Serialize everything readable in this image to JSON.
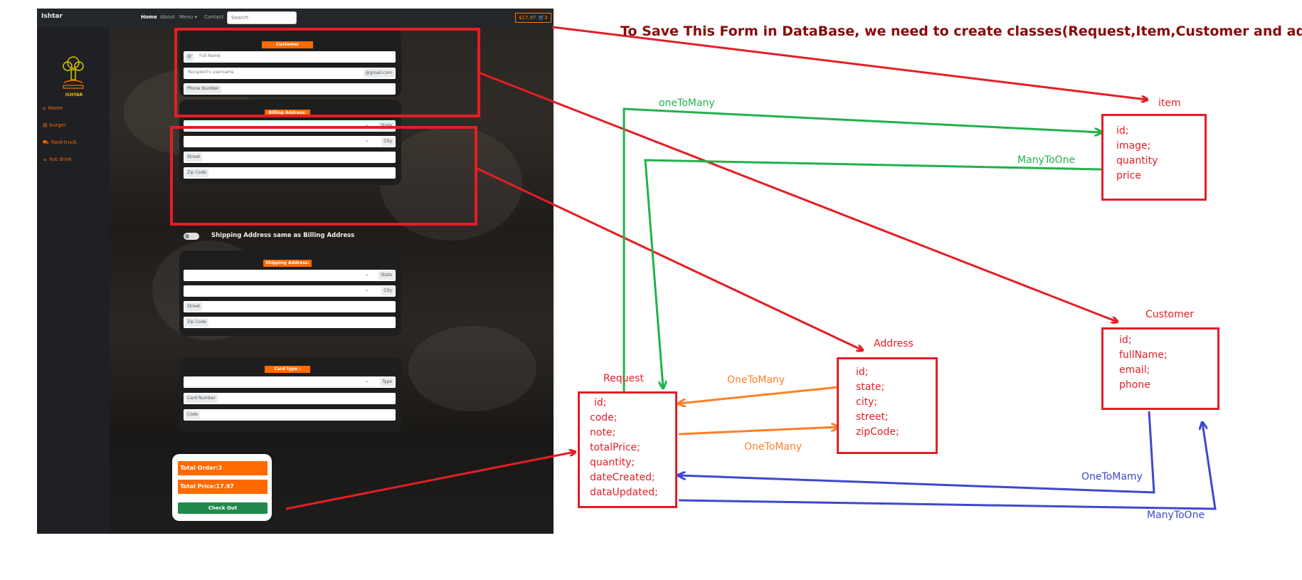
{
  "screenshot": {
    "brand": "Ishtar",
    "nav": {
      "home": "Home",
      "about": "About",
      "menu": "Menu ▾",
      "contact": "Contact"
    },
    "search_placeholder": "Search",
    "cart_total": "$17.97",
    "cart_count": "3",
    "logo_text": "ISHTAR",
    "sidebar": [
      {
        "icon": "home-icon",
        "label": "Home"
      },
      {
        "icon": "burger-icon",
        "label": "burger"
      },
      {
        "icon": "food-truck-icon",
        "label": "food-truck"
      },
      {
        "icon": "hot-drink-icon",
        "label": "hot drink"
      }
    ],
    "customer": {
      "legend": "Customer",
      "fullname_prefix": "@",
      "fullname_placeholder": "Full Name",
      "email_placeholder": "Recipient's username",
      "email_suffix": "@gmail.com",
      "phone_label": "Phone Number"
    },
    "billing": {
      "legend": "Billing Address:",
      "state_label": "State",
      "city_label": "City",
      "street_label": "Street",
      "zip_label": "Zip Code"
    },
    "shipping_toggle_label": "Shipping Address same as Billing Address",
    "shipping": {
      "legend": "Shipping Address:",
      "state_label": "State",
      "city_label": "City",
      "street_label": "Street",
      "zip_label": "Zip Code"
    },
    "card": {
      "legend": "Card type :",
      "type_label": "Type",
      "number_label": "Card Number",
      "code_label": "Code"
    },
    "totals": {
      "total_order": "Total Order:3",
      "total_price": "Total Price:17.97",
      "checkout": "Check Out"
    }
  },
  "diagram": {
    "title": "To Save This Form in DataBase, we need to create classes(Request,Item,Customer and address)",
    "classes": {
      "item": {
        "name": "item",
        "fields": [
          "id;",
          "image;",
          "quantity",
          "price"
        ]
      },
      "customer": {
        "name": "Customer",
        "fields": [
          "id;",
          "fullName;",
          "email;",
          "phone"
        ]
      },
      "address": {
        "name": "Address",
        "fields": [
          "id;",
          "state;",
          "city;",
          "street;",
          "zipCode;"
        ]
      },
      "request": {
        "name": "Request",
        "fields": [
          "id;",
          "code;",
          "note;",
          "totalPrice;",
          "quantity;",
          "dateCreated;",
          "dataUpdated;"
        ]
      }
    },
    "relations": {
      "request_item_one": "oneToMany",
      "item_request_many": "ManyToOne",
      "address_request": "OneToMany",
      "request_address": "OneToMany",
      "customer_request": "OneToMamy",
      "request_customer": "ManyToOne"
    },
    "colors": {
      "red": "#e41e26",
      "green": "#22b14c",
      "orange": "#ff7f27",
      "blue": "#3f48cc",
      "title": "#8b0a0a"
    }
  }
}
